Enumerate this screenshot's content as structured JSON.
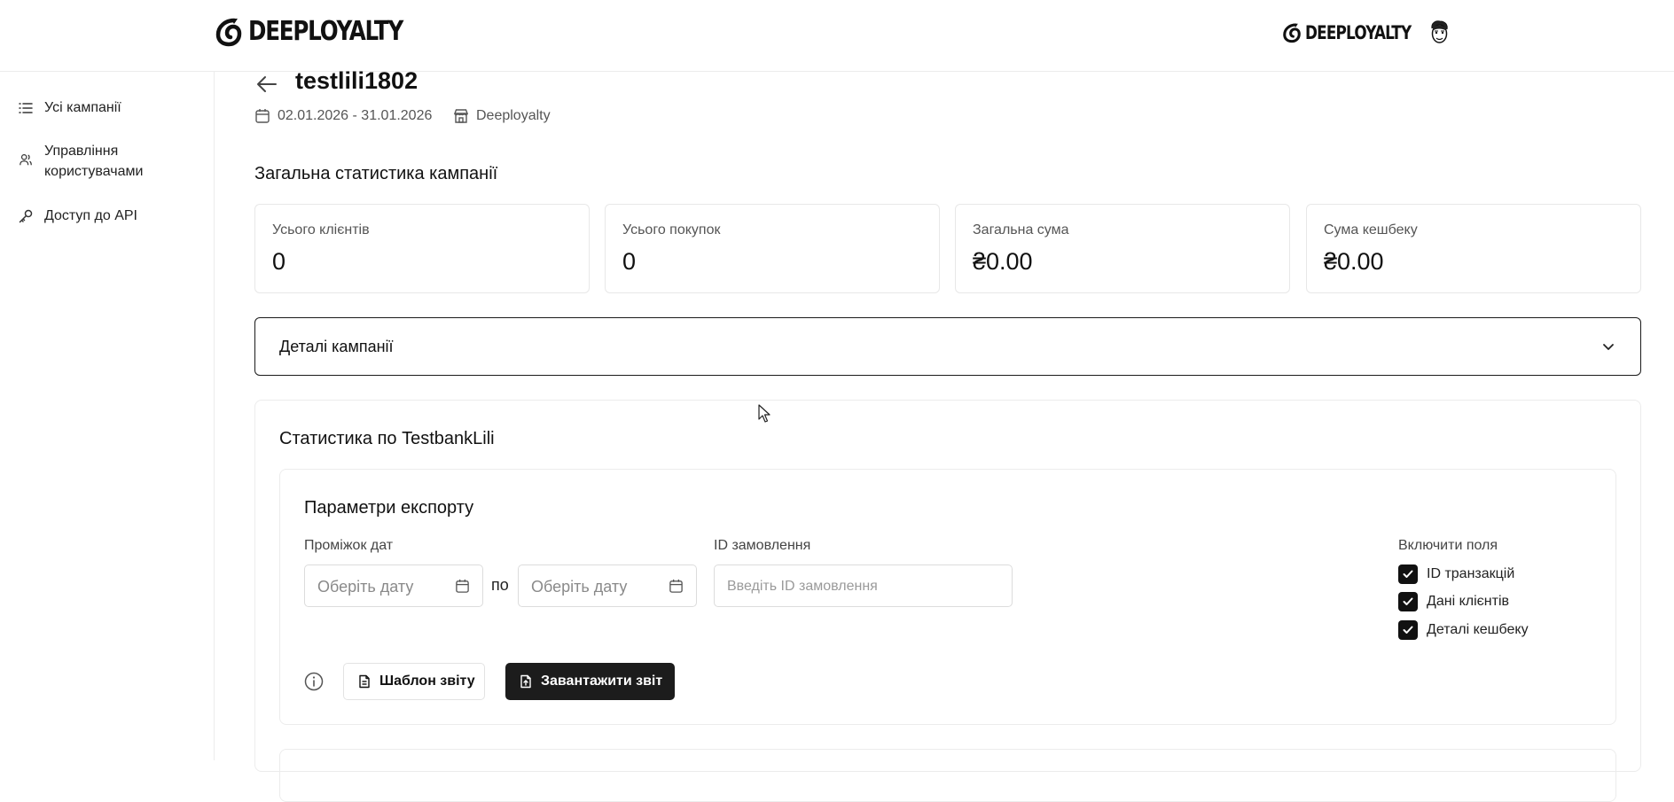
{
  "header": {
    "brand": "DEEPLOYALTY",
    "brand_right": "DEEPLOYALTY"
  },
  "sidebar": {
    "items": [
      {
        "label": "Усі кампанії",
        "icon": "list-icon"
      },
      {
        "label": "Управління користувачами",
        "icon": "users-icon"
      },
      {
        "label": "Доступ до API",
        "icon": "key-icon"
      }
    ]
  },
  "campaign": {
    "title": "testlili1802",
    "date_range": "02.01.2026 - 31.01.2026",
    "store": "Deeployalty"
  },
  "overview": {
    "title": "Загальна статистика кампанії",
    "stats": [
      {
        "label": "Усього клієнтів",
        "value": "0"
      },
      {
        "label": "Усього покупок",
        "value": "0"
      },
      {
        "label": "Загальна сума",
        "value": "₴0.00"
      },
      {
        "label": "Сума кешбеку",
        "value": "₴0.00"
      }
    ]
  },
  "details": {
    "label": "Деталі кампанії"
  },
  "bank_stats": {
    "title": "Статистика по TestbankLili"
  },
  "export": {
    "title": "Параметри експорту",
    "date_range_label": "Проміжок дат",
    "date_from_placeholder": "Оберіть дату",
    "separator": "по",
    "date_to_placeholder": "Оберіть дату",
    "order_label": "ID замовлення",
    "order_placeholder": "Введіть ID замовлення",
    "fields_label": "Включити поля",
    "fields": [
      {
        "label": "ID транзакцій",
        "checked": true
      },
      {
        "label": "Дані клієнтів",
        "checked": true
      },
      {
        "label": "Деталі кешбеку",
        "checked": true
      }
    ],
    "template_button": "Шаблон звіту",
    "download_button": "Завантажити звіт"
  }
}
